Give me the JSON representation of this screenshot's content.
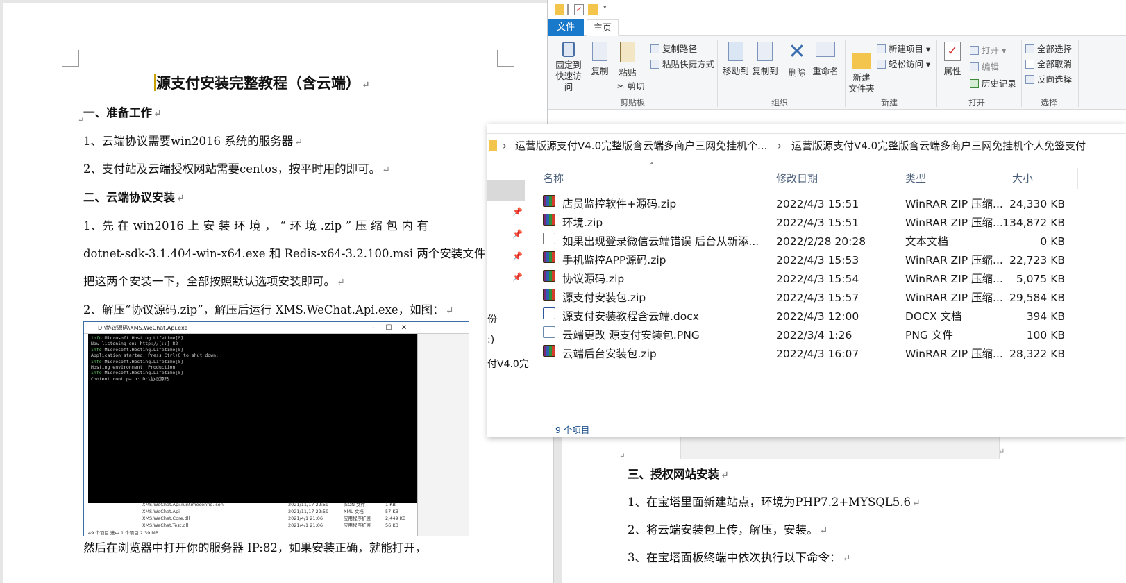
{
  "doc": {
    "title": "源支付安装完整教程（含云端）",
    "para_mark": "↵",
    "sec1": "一、准备工作",
    "p1": "1、云端协议需要win2016 系统的服务器",
    "p2": "2、支付站及云端授权网站需要centos，按平时用的即可。",
    "sec2": "二、云端协议安装",
    "p3a": "1、先 在 win2016 上 安 装 环 境 ， “ 环 境 .zip ” 压 缩 包 内 有",
    "p3b": "dotnet-sdk-3.1.404-win-x64.exe 和 Redis-x64-3.2.100.msi 两个安装文件，",
    "p3c": "把这两个安装一下，全部按照默认选项安装即可。",
    "p4": "2、解压“协议源码.zip”，解压后运行 XMS.WeChat.Api.exe，如图：",
    "p5": "然后在浏览器中打开你的服务器 IP:82，如果安装正确，就能打开，",
    "sec3": "三、授权网站安装",
    "q1": "1、在宝塔里面新建站点，环境为PHP7.2+MYSQL5.6",
    "q2": "2、将云端安装包上传，解压，安装。",
    "q3": "3、在宝塔面板终端中依次执行以下命令："
  },
  "embed": {
    "title": "D:\\协议源码\\XMS.WeChat.Api.exe",
    "console": [
      {
        "tag": "info:",
        "text": "Microsoft.Hosting.Lifetime[0]"
      },
      {
        "tag": "",
        "text": "      Now listening on: http://[::]:82"
      },
      {
        "tag": "info:",
        "text": "Microsoft.Hosting.Lifetime[0]"
      },
      {
        "tag": "",
        "text": "      Application started. Press Ctrl+C to shut down."
      },
      {
        "tag": "info:",
        "text": "Microsoft.Hosting.Lifetime[0]"
      },
      {
        "tag": "",
        "text": "      Hosting environment: Production"
      },
      {
        "tag": "info:",
        "text": "Microsoft.Hosting.Lifetime[0]"
      },
      {
        "tag": "",
        "text": "      Content root path: D:\\协议源码"
      }
    ],
    "files": [
      [
        "XMS.WeChat.Api.runtimeconfig.json",
        "2021/11/17 22:59",
        "JSON 文件",
        "1 KB"
      ],
      [
        "XMS.WeChat.Api",
        "2021/11/17 22:59",
        "XML 文档",
        "57 KB"
      ],
      [
        "XMS.WeChat.Core.dll",
        "2021/4/1 21:06",
        "应用程序扩展",
        "2,449 KB"
      ],
      [
        "XMS.WeChat.Test.dll",
        "2021/4/1 21:06",
        "应用程序扩展",
        "56 KB"
      ]
    ],
    "status": "49 个项目    选中 1 个项目  2.39 MB"
  },
  "ribbon": {
    "tab_file": "文件",
    "tab_home": "主页",
    "pin": "固定到快速访问",
    "copy": "复制",
    "paste": "粘贴",
    "copy_path": "复制路径",
    "paste_shortcut": "粘贴快捷方式",
    "cut": "剪切",
    "move_to": "移动到",
    "copy_to": "复制到",
    "delete": "删除",
    "rename": "重命名",
    "new_folder": "新建\n文件夹",
    "new_item": "新建项目",
    "easy_access": "轻松访问",
    "properties": "属性",
    "open": "打开",
    "edit": "编辑",
    "history": "历史记录",
    "select_all": "全部选择",
    "select_none": "全部取消",
    "invert": "反向选择",
    "g_clipboard": "剪贴板",
    "g_organize": "组织",
    "g_new": "新建",
    "g_open": "打开",
    "g_select": "选择"
  },
  "explorer": {
    "crumb1": "运营版源支付V4.0完整版含云端多商户三网免挂机个...",
    "crumb2": "运营版源支付V4.0完整版含云端多商户三网免挂机个人免签支付",
    "columns": {
      "name": "名称",
      "date": "修改日期",
      "type": "类型",
      "size": "大小"
    },
    "files": [
      {
        "name": "店员监控软件+源码.zip",
        "date": "2022/4/3 15:51",
        "type": "WinRAR ZIP 压缩...",
        "size": "24,330 KB",
        "kind": "zip"
      },
      {
        "name": "环境.zip",
        "date": "2022/4/3 15:51",
        "type": "WinRAR ZIP 压缩...",
        "size": "134,872 KB",
        "kind": "zip"
      },
      {
        "name": "如果出现登录微信云端错误 后台从新添...",
        "date": "2022/2/28 20:28",
        "type": "文本文档",
        "size": "0 KB",
        "kind": "txt"
      },
      {
        "name": "手机监控APP源码.zip",
        "date": "2022/4/3 15:53",
        "type": "WinRAR ZIP 压缩...",
        "size": "22,723 KB",
        "kind": "zip"
      },
      {
        "name": "协议源码.zip",
        "date": "2022/4/3 15:54",
        "type": "WinRAR ZIP 压缩...",
        "size": "5,075 KB",
        "kind": "zip"
      },
      {
        "name": "源支付安装包.zip",
        "date": "2022/4/3 15:57",
        "type": "WinRAR ZIP 压缩...",
        "size": "29,584 KB",
        "kind": "zip"
      },
      {
        "name": "源支付安装教程含云端.docx",
        "date": "2022/4/3 12:00",
        "type": "DOCX 文档",
        "size": "394 KB",
        "kind": "doc"
      },
      {
        "name": "云端更改  源支付安装包.PNG",
        "date": "2022/3/4 1:26",
        "type": "PNG 文件",
        "size": "100 KB",
        "kind": "png"
      },
      {
        "name": "云端后台安装包.zip",
        "date": "2022/4/3 16:07",
        "type": "WinRAR ZIP 压缩...",
        "size": "28,322 KB",
        "kind": "zip"
      }
    ],
    "nav_items": [
      "份",
      ":)",
      "付V4.0完"
    ],
    "status": "9 个项目"
  }
}
